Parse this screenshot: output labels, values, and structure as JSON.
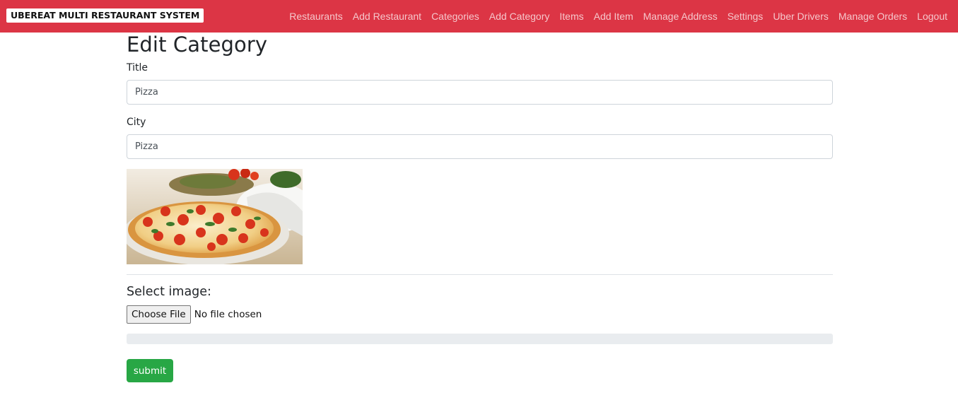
{
  "navbar": {
    "brand": "UBEREAT MULTI RESTAURANT SYSTEM",
    "links": [
      {
        "id": "restaurants",
        "label": "Restaurants"
      },
      {
        "id": "add-restaurant",
        "label": "Add Restaurant"
      },
      {
        "id": "categories",
        "label": "Categories"
      },
      {
        "id": "add-category",
        "label": "Add Category"
      },
      {
        "id": "items",
        "label": "Items"
      },
      {
        "id": "add-item",
        "label": "Add Item"
      },
      {
        "id": "manage-address",
        "label": "Manage Address"
      },
      {
        "id": "settings",
        "label": "Settings"
      },
      {
        "id": "uber-drivers",
        "label": "Uber Drivers"
      },
      {
        "id": "manage-orders",
        "label": "Manage Orders"
      },
      {
        "id": "logout",
        "label": "Logout"
      }
    ],
    "color": "#dc3545"
  },
  "form": {
    "heading": "Edit Category",
    "title_label": "Title",
    "title_value": "Pizza",
    "city_label": "City",
    "city_value": "Pizza",
    "select_image_label": "Select image:",
    "choose_file_label": "Choose File",
    "file_status": "No file chosen",
    "upload_progress": 0,
    "submit_label": "submit",
    "submit_color": "#28a745"
  }
}
